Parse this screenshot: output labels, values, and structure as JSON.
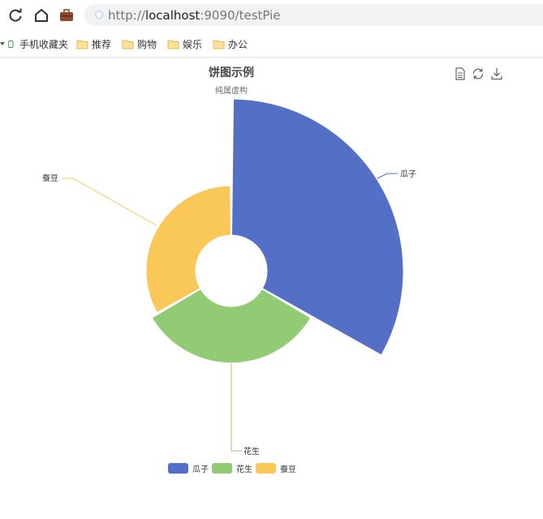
{
  "browser": {
    "url_prefix": "http://",
    "url_host": "localhost",
    "url_rest": ":9090/testPie",
    "bookmarks": [
      {
        "label": "手机收藏夹",
        "icon": "mobile-icon"
      },
      {
        "label": "推荐",
        "icon": "folder-icon"
      },
      {
        "label": "购物",
        "icon": "folder-icon"
      },
      {
        "label": "娱乐",
        "icon": "folder-icon"
      },
      {
        "label": "办公",
        "icon": "folder-icon"
      }
    ]
  },
  "chart_data": {
    "type": "pie",
    "variant": "rose-radius",
    "title": "饼图示例",
    "subtitle": "纯属虚构",
    "series": [
      {
        "name": "瓜子",
        "value": 1548,
        "color": "#5470c6"
      },
      {
        "name": "花生",
        "value": 1044,
        "color": "#91cc75"
      },
      {
        "name": "蚕豆",
        "value": 1000,
        "color": "#fac858"
      }
    ],
    "legend_position": "bottom-center",
    "toolbox": [
      "data-view-icon",
      "restore-icon",
      "save-image-icon"
    ]
  }
}
